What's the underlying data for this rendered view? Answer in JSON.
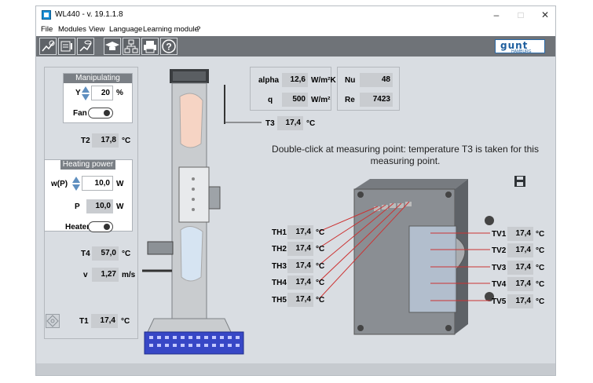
{
  "window": {
    "title": "WL440 - v. 19.1.1.8"
  },
  "titlebar": {
    "minimize": "–",
    "maximize": "□",
    "close": "✕"
  },
  "menu": [
    "File",
    "Modules",
    "View",
    "Language",
    "Learning module",
    "?"
  ],
  "toolbar": {
    "icons": [
      "chart-wizard-icon",
      "measurement-icon",
      "chart-view-icon",
      "learning-icon",
      "network-icon",
      "print-icon",
      "help-icon"
    ],
    "help_glyph": "?",
    "logo_text": "gunt",
    "logo_sub": "HAMBURG"
  },
  "left": {
    "manip": {
      "title": "Manipulating variable",
      "y_label": "Y",
      "y_value": "20",
      "y_unit": "%",
      "fan_label": "Fan"
    },
    "t2": {
      "label": "T2",
      "value": "17,8",
      "unit": "°C"
    },
    "heating": {
      "title": "Heating power",
      "wp_label": "w(P)",
      "wp_value": "10,0",
      "wp_unit": "W",
      "p_label": "P",
      "p_value": "10,0",
      "p_unit": "W",
      "heater_label": "Heater"
    },
    "t4": {
      "label": "T4",
      "value": "57,0",
      "unit": "°C"
    },
    "v": {
      "label": "v",
      "value": "1,27",
      "unit": "m/s"
    },
    "t1": {
      "label": "T1",
      "value": "17,4",
      "unit": "°C"
    }
  },
  "results": {
    "alpha": {
      "label": "alpha",
      "value": "12,6",
      "unit": "W/m²K"
    },
    "q": {
      "label": "q",
      "value": "500",
      "unit": "W/m²"
    },
    "nu": {
      "label": "Nu",
      "value": "48"
    },
    "re": {
      "label": "Re",
      "value": "7423"
    }
  },
  "t3": {
    "label": "T3",
    "value": "17,4",
    "unit": "°C"
  },
  "message": "Double-click at measuring point: temperature T3 is taken for this measuring point.",
  "th": [
    {
      "label": "TH1",
      "value": "17,4",
      "unit": "°C"
    },
    {
      "label": "TH2",
      "value": "17,4",
      "unit": "°C"
    },
    {
      "label": "TH3",
      "value": "17,4",
      "unit": "°C"
    },
    {
      "label": "TH4",
      "value": "17,4",
      "unit": "°C"
    },
    {
      "label": "TH5",
      "value": "17,4",
      "unit": "°C"
    }
  ],
  "tv": [
    {
      "label": "TV1",
      "value": "17,4",
      "unit": "°C"
    },
    {
      "label": "TV2",
      "value": "17,4",
      "unit": "°C"
    },
    {
      "label": "TV3",
      "value": "17,4",
      "unit": "°C"
    },
    {
      "label": "TV4",
      "value": "17,4",
      "unit": "°C"
    },
    {
      "label": "TV5",
      "value": "17,4",
      "unit": "°C"
    }
  ]
}
